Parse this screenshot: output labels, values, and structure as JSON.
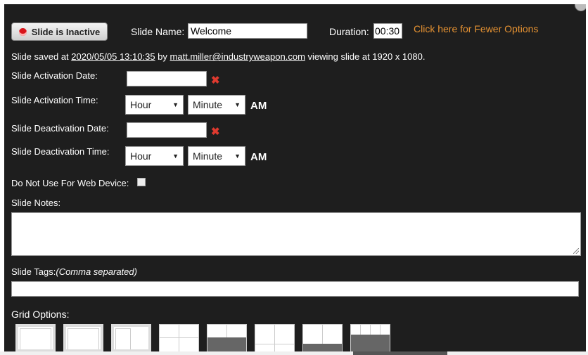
{
  "header": {
    "status_button_label": "Slide is Inactive",
    "slide_name_label": "Slide Name:",
    "slide_name_value": "Welcome",
    "duration_label": "Duration:",
    "duration_value": "00:30",
    "fewer_options_link": "Click here for Fewer Options"
  },
  "saved_info": {
    "prefix": "Slide saved at ",
    "timestamp": "2020/05/05 13:10:35",
    "by": " by ",
    "user": "matt.miller@industryweapon.com",
    "suffix": " viewing slide at 1920 x 1080."
  },
  "activation": {
    "date_label": "Slide Activation Date:",
    "time_label": "Slide Activation Time:",
    "hour": "Hour",
    "minute": "Minute",
    "ampm": "AM"
  },
  "deactivation": {
    "date_label": "Slide Deactivation Date:",
    "time_label": "Slide Deactivation Time:",
    "hour": "Hour",
    "minute": "Minute",
    "ampm": "AM"
  },
  "web_device_label": "Do Not Use For Web Device:",
  "notes_label": "Slide Notes:",
  "tags_label": "Slide Tags:",
  "tags_hint": "(Comma separated)",
  "grid_options_label": "Grid Options:",
  "clear_icon": "✖",
  "select_arrow": "▼",
  "colors": {
    "panel_bg": "#1e1e1e",
    "link_orange": "#e69232",
    "clear_red": "#e03a2f",
    "status_dot": "#d8141a"
  }
}
